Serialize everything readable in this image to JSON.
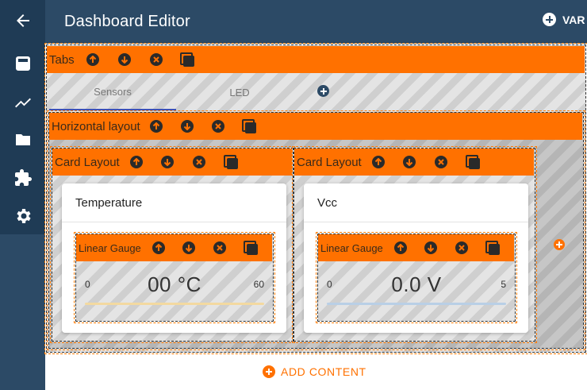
{
  "header": {
    "title": "Dashboard Editor",
    "var_label": "VAR"
  },
  "sidebar": {
    "items": [
      {
        "icon": "arrow-left-icon"
      },
      {
        "icon": "dashboard-icon"
      },
      {
        "icon": "chart-line-icon"
      },
      {
        "icon": "folder-icon"
      },
      {
        "icon": "puzzle-icon"
      },
      {
        "icon": "gear-icon"
      }
    ]
  },
  "tabs_layout": {
    "label": "Tabs",
    "tabs": [
      {
        "label": "Sensors",
        "active": true
      },
      {
        "label": "LED",
        "active": false
      }
    ]
  },
  "horizontal_layout": {
    "label": "Horizontal layout"
  },
  "cards": [
    {
      "layout_label": "Card Layout",
      "title": "Temperature",
      "gauge": {
        "label": "Linear Gauge",
        "min": "0",
        "max": "60",
        "value": "00 °C",
        "track_color": "#f3d9a0"
      }
    },
    {
      "layout_label": "Card Layout",
      "title": "Vcc",
      "gauge": {
        "label": "Linear Gauge",
        "min": "0",
        "max": "5",
        "value": "0.0 V",
        "track_color": "#b9cfe6"
      }
    }
  ],
  "footer": {
    "add_content_label": "ADD CONTENT"
  },
  "colors": {
    "header_bg": "#2c4a66",
    "accent": "#ff7100",
    "tab_indicator": "#3f51b5"
  }
}
